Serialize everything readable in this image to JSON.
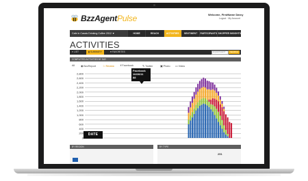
{
  "header": {
    "brand_main": "BzzAgent",
    "brand_accent": "Pulse",
    "welcome": "Welcome, FirstName Darcy",
    "account_links": "Logout · My Account"
  },
  "nav": {
    "campaign": "Cafe in Cassis Drinking Coffee 2012 ▼",
    "tabs": [
      "HOME",
      "REACH",
      "ACTIVITIES",
      "SENTIMENT",
      "PARTICIPANTS",
      "SHOPPER INSIGHTS"
    ],
    "active_index": 2
  },
  "page": {
    "title": "ACTIVITIES",
    "subtabs": [
      "LIST",
      "SUMMARY",
      "FAVORITES"
    ],
    "active_subtab": 1,
    "search_placeholder": "keyword search",
    "search_button": "SEARCH"
  },
  "activities_panel": {
    "title": "COMPLETED ACTIVITIES BY DAY",
    "filters": [
      "All",
      "BzzReport",
      "Review",
      "Facebook",
      "Twitter",
      "Photo",
      "Video"
    ],
    "active_filter": 2
  },
  "tooltip": {
    "line1": "Facebook",
    "line2": "10/26/11",
    "line3": "88"
  },
  "date_label": "DATE",
  "lower": {
    "region_title": "BY REGION",
    "type_title": "BY TYPE",
    "type_value": "251"
  },
  "colors": {
    "accent": "#f2b51c",
    "blue": "#1f5fae",
    "green": "#8cbf2e",
    "orange": "#f5a623",
    "purple": "#7b2a9a",
    "red": "#c8102e"
  },
  "chart_data": {
    "type": "bar",
    "stacked": true,
    "y_ticks": [
      "2,800",
      "2,600",
      "2,400",
      "2,200",
      "2,000",
      "1,800",
      "1,600",
      "1,400",
      "1,200",
      "1,000",
      "800",
      "600",
      "400",
      "200",
      "0"
    ],
    "ylim": [
      0,
      2800
    ],
    "xlabel": "DATE",
    "series": [
      {
        "color": "#1f5fae",
        "values": [
          0,
          0,
          0,
          0,
          0,
          0,
          0,
          0,
          0,
          0,
          0,
          0,
          0,
          0,
          0,
          0,
          0,
          0,
          0,
          0,
          0,
          0,
          0,
          0,
          0,
          0,
          0,
          0,
          0,
          0,
          0,
          0,
          0,
          0,
          0,
          0,
          0,
          0,
          0,
          0,
          0,
          0,
          0,
          0,
          0,
          0,
          0,
          0,
          0,
          0,
          0,
          0,
          0,
          0,
          0,
          600,
          760,
          900,
          1050,
          1200,
          1300,
          1400,
          1450,
          1500,
          1480,
          1420,
          1350,
          1250,
          1150,
          1000,
          850,
          700,
          550,
          400,
          250,
          150,
          80,
          0,
          0
        ]
      },
      {
        "color": "#8cbf2e",
        "values": [
          0,
          0,
          0,
          0,
          0,
          0,
          0,
          0,
          0,
          0,
          0,
          0,
          0,
          0,
          0,
          0,
          0,
          0,
          0,
          0,
          0,
          0,
          0,
          0,
          0,
          0,
          0,
          0,
          0,
          0,
          0,
          0,
          0,
          0,
          0,
          0,
          0,
          0,
          0,
          0,
          0,
          0,
          0,
          0,
          0,
          0,
          0,
          0,
          0,
          0,
          0,
          0,
          0,
          0,
          0,
          200,
          220,
          230,
          240,
          250,
          260,
          260,
          260,
          250,
          250,
          240,
          230,
          220,
          300,
          380,
          420,
          440,
          420,
          380,
          300,
          200,
          100,
          0,
          0
        ]
      },
      {
        "color": "#c8102e",
        "values": [
          0,
          0,
          0,
          0,
          0,
          0,
          0,
          0,
          0,
          0,
          0,
          0,
          0,
          0,
          0,
          0,
          0,
          0,
          0,
          0,
          0,
          0,
          0,
          0,
          0,
          0,
          0,
          0,
          0,
          0,
          0,
          0,
          0,
          0,
          0,
          0,
          0,
          0,
          0,
          0,
          0,
          0,
          0,
          0,
          0,
          0,
          0,
          0,
          0,
          0,
          0,
          0,
          0,
          0,
          0,
          0,
          0,
          0,
          0,
          0,
          0,
          0,
          0,
          0,
          0,
          0,
          100,
          200,
          280,
          340,
          400,
          460,
          500,
          560,
          620,
          680,
          720,
          700,
          650
        ]
      },
      {
        "color": "#f5a623",
        "values": [
          0,
          0,
          0,
          0,
          0,
          0,
          0,
          0,
          0,
          0,
          0,
          0,
          0,
          0,
          0,
          0,
          0,
          0,
          0,
          0,
          0,
          0,
          0,
          0,
          0,
          0,
          0,
          0,
          0,
          0,
          0,
          0,
          0,
          0,
          0,
          0,
          0,
          0,
          0,
          0,
          0,
          0,
          0,
          0,
          0,
          0,
          0,
          0,
          0,
          0,
          0,
          0,
          0,
          0,
          0,
          300,
          350,
          400,
          420,
          440,
          460,
          470,
          480,
          480,
          470,
          460,
          440,
          420,
          390,
          350,
          300,
          250,
          200,
          150,
          100,
          0,
          0,
          0,
          0
        ]
      },
      {
        "color": "#7b2a9a",
        "values": [
          0,
          0,
          0,
          0,
          0,
          0,
          0,
          0,
          0,
          0,
          0,
          0,
          0,
          0,
          0,
          0,
          0,
          0,
          0,
          0,
          0,
          0,
          0,
          0,
          0,
          0,
          0,
          0,
          0,
          0,
          0,
          0,
          0,
          0,
          0,
          0,
          0,
          0,
          0,
          0,
          0,
          0,
          0,
          0,
          0,
          0,
          0,
          0,
          0,
          0,
          0,
          0,
          0,
          0,
          0,
          250,
          260,
          280,
          300,
          320,
          340,
          360,
          380,
          400,
          390,
          380,
          360,
          340,
          300,
          260,
          220,
          180,
          150,
          120,
          90,
          0,
          0,
          0,
          0
        ]
      }
    ]
  }
}
